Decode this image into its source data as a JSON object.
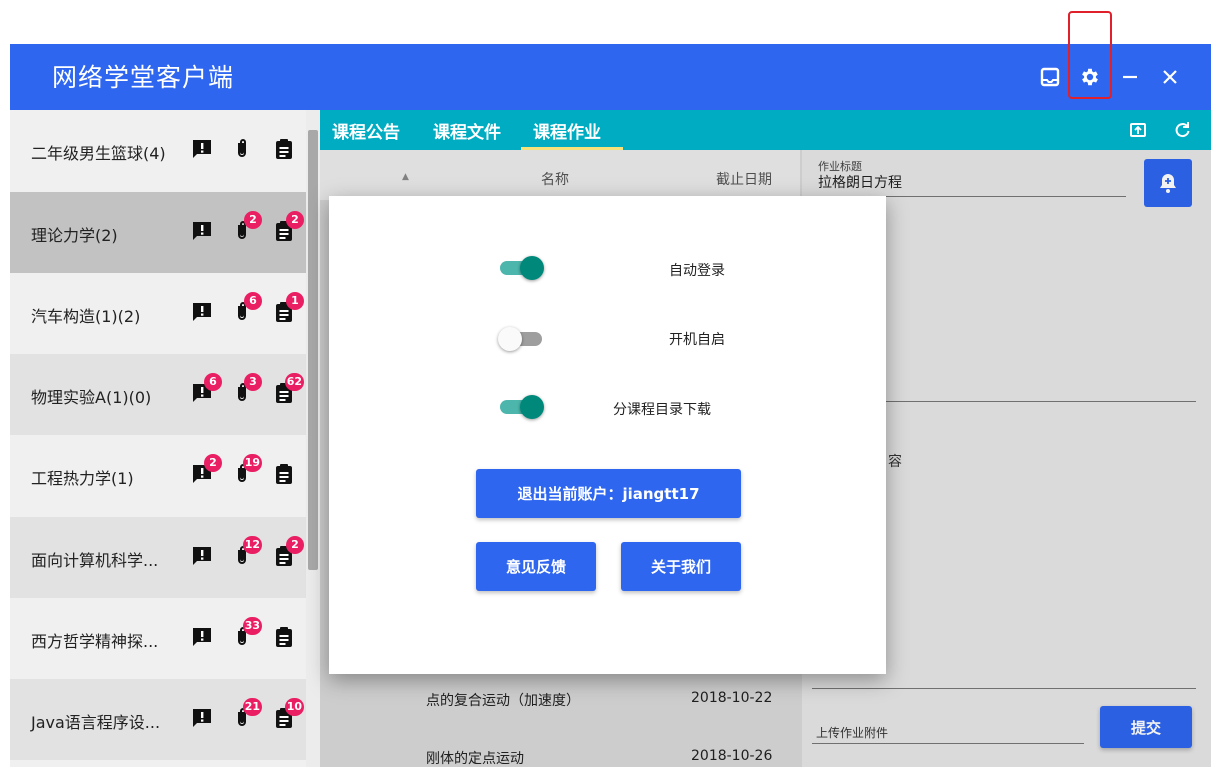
{
  "app": {
    "title": "网络学堂客户端"
  },
  "titlebar_icons": [
    "inbox-icon",
    "gear-icon",
    "minimize-icon",
    "close-icon"
  ],
  "sidebar": {
    "courses": [
      {
        "name": "二年级男生篮球(4)",
        "notice_badge": "",
        "file_badge": "",
        "work_badge": ""
      },
      {
        "name": "理论力学(2)",
        "notice_badge": "",
        "file_badge": "2",
        "work_badge": "2"
      },
      {
        "name": "汽车构造(1)(2)",
        "notice_badge": "",
        "file_badge": "6",
        "work_badge": "1"
      },
      {
        "name": "物理实验A(1)(0)",
        "notice_badge": "6",
        "file_badge": "3",
        "work_badge": "62"
      },
      {
        "name": "工程热力学(1)",
        "notice_badge": "2",
        "file_badge": "19",
        "work_badge": ""
      },
      {
        "name": "面向计算机科学...",
        "notice_badge": "",
        "file_badge": "12",
        "work_badge": "2"
      },
      {
        "name": "西方哲学精神探...",
        "notice_badge": "",
        "file_badge": "33",
        "work_badge": ""
      },
      {
        "name": "Java语言程序设...",
        "notice_badge": "",
        "file_badge": "21",
        "work_badge": "10"
      }
    ]
  },
  "tabs": [
    "课程公告",
    "课程文件",
    "课程作业"
  ],
  "list": {
    "col_name": "名称",
    "col_deadline": "截止日期",
    "rows": [
      {
        "name": "点的复合运动（加速度）",
        "date": "2018-10-22"
      },
      {
        "name": "刚体的定点运动",
        "date": "2018-10-26"
      }
    ]
  },
  "detail": {
    "title_label": "作业标题",
    "title_value": "拉格朗日方程",
    "content_fragment": "容",
    "upload_label": "上传作业附件",
    "submit": "提交"
  },
  "dialog": {
    "options": [
      {
        "label": "自动登录",
        "on": true
      },
      {
        "label": "开机自启",
        "on": false
      },
      {
        "label": "分课程目录下载",
        "on": true
      }
    ],
    "logout": "退出当前账户：jiangtt17",
    "feedback": "意见反馈",
    "about": "关于我们"
  },
  "colors": {
    "primary": "#2e66f0",
    "tabbar": "#00acc1",
    "toggle_on": "#00897b",
    "badge": "#e91e63",
    "highlight": "#e0202a"
  }
}
